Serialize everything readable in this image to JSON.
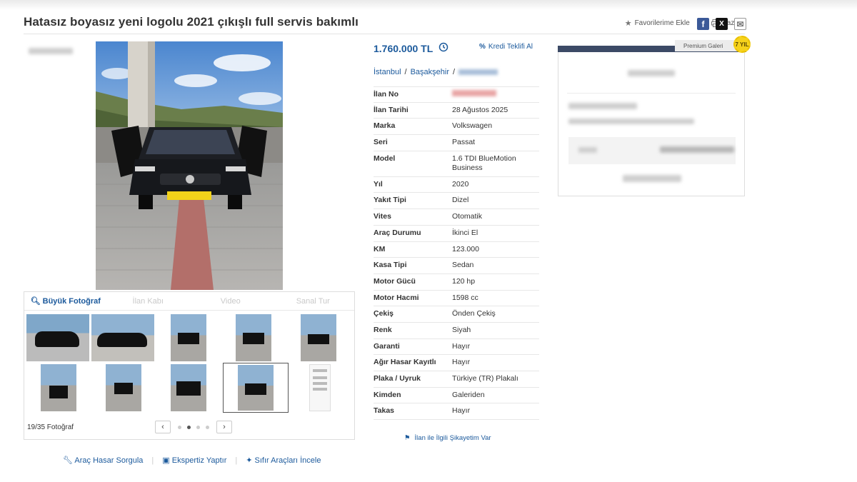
{
  "listing": {
    "title": "Hatasız boyasız yeni logolu 2021 çıkışlı full servis bakımlı",
    "price": "1.760.000 TL",
    "kredi_label": "Kredi Teklifi Al",
    "location": [
      "İstanbul",
      "Başakşehir"
    ]
  },
  "toolbar": {
    "favorite_label": "Favorilerime Ekle",
    "print_label": "Yazdır"
  },
  "social": {
    "facebook": "f",
    "x": "X",
    "mail": "✉"
  },
  "gallery": {
    "tabs": [
      "Büyük Fotoğraf",
      "İlan Kabı",
      "Video",
      "Sanal Tur"
    ],
    "photo_count": "19/35 Fotoğraf",
    "prev": "‹",
    "next": "›"
  },
  "bottom_links": {
    "hasar": "Araç Hasar Sorgula",
    "ekspertiz": "Ekspertiz Yaptır",
    "sifir": "Sıfır Araçları İncele"
  },
  "specs": [
    {
      "k": "İlan No",
      "v": ""
    },
    {
      "k": "İlan Tarihi",
      "v": "28 Ağustos 2025"
    },
    {
      "k": "Marka",
      "v": "Volkswagen"
    },
    {
      "k": "Seri",
      "v": "Passat"
    },
    {
      "k": "Model",
      "v": "1.6 TDI BlueMotion Business"
    },
    {
      "k": "Yıl",
      "v": "2020"
    },
    {
      "k": "Yakıt Tipi",
      "v": "Dizel"
    },
    {
      "k": "Vites",
      "v": "Otomatik"
    },
    {
      "k": "Araç Durumu",
      "v": "İkinci El"
    },
    {
      "k": "KM",
      "v": "123.000"
    },
    {
      "k": "Kasa Tipi",
      "v": "Sedan"
    },
    {
      "k": "Motor Gücü",
      "v": "120 hp"
    },
    {
      "k": "Motor Hacmi",
      "v": "1598 cc"
    },
    {
      "k": "Çekiş",
      "v": "Önden Çekiş"
    },
    {
      "k": "Renk",
      "v": "Siyah"
    },
    {
      "k": "Garanti",
      "v": "Hayır"
    },
    {
      "k": "Ağır Hasar Kayıtlı",
      "v": "Hayır"
    },
    {
      "k": "Plaka / Uyruk",
      "v": "Türkiye (TR) Plakalı"
    },
    {
      "k": "Kimden",
      "v": "Galeriden"
    },
    {
      "k": "Takas",
      "v": "Hayır"
    }
  ],
  "complaint_label": "İlan ile İlgili Şikayetim Var",
  "seller": {
    "premium_label": "Premium Galeri",
    "badge": "7 YIL"
  },
  "colors": {
    "link": "#1c5a9c",
    "seller_bar": "#3c4a66",
    "badge": "#f6d21b"
  }
}
